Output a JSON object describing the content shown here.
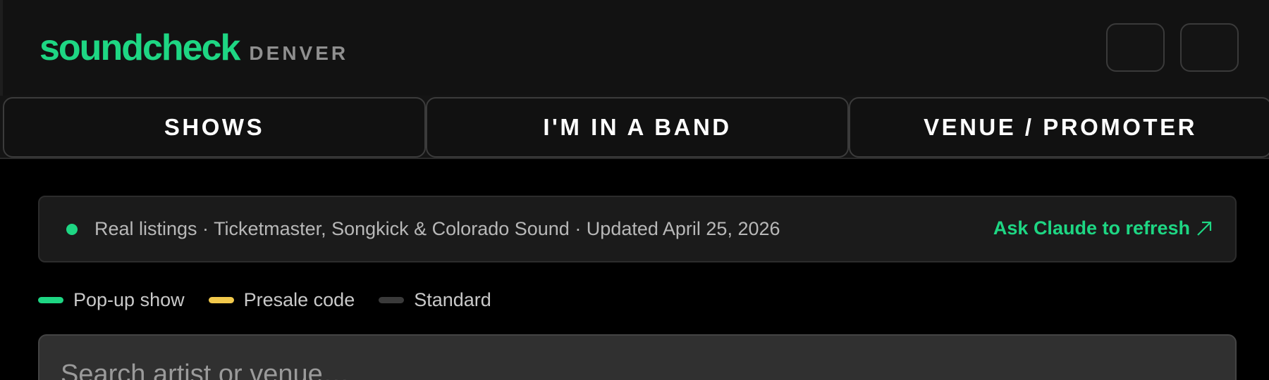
{
  "brand": {
    "name": "soundcheck",
    "city": "DENVER"
  },
  "tabs": [
    {
      "label": "SHOWS"
    },
    {
      "label": "I'M IN A BAND"
    },
    {
      "label": "VENUE / PROMOTER"
    }
  ],
  "banner": {
    "text": "Real listings · Ticketmaster, Songkick & Colorado Sound · Updated April 25, 2026",
    "refresh_label": "Ask Claude to refresh",
    "status_color": "#1ed683"
  },
  "legend": [
    {
      "label": "Pop-up show",
      "color": "#1ed683"
    },
    {
      "label": "Presale code",
      "color": "#f2c94c"
    },
    {
      "label": "Standard",
      "color": "#3a3a3a"
    }
  ],
  "search": {
    "placeholder": "Search artist or venue…"
  },
  "colors": {
    "accent": "#1ed683",
    "background": "#000000"
  }
}
